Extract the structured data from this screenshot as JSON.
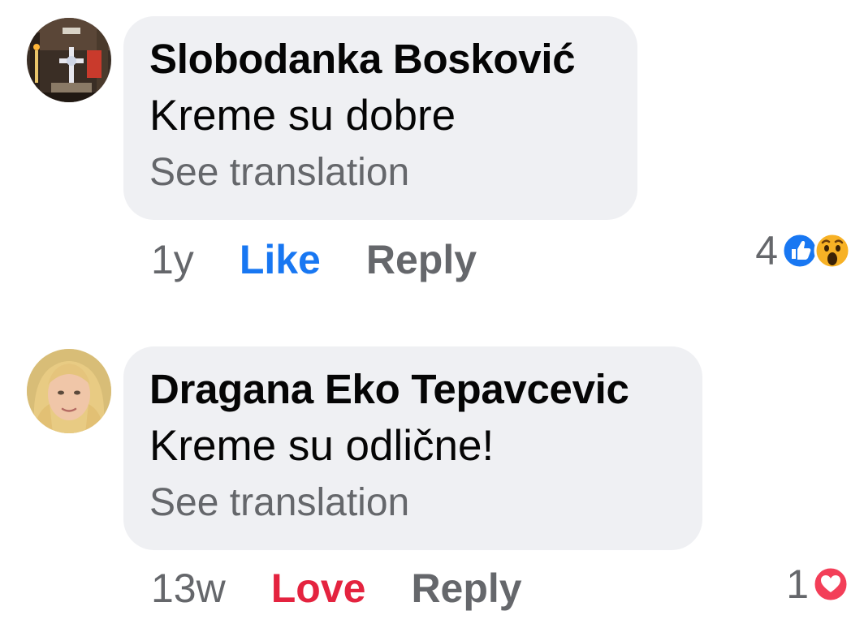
{
  "comments": [
    {
      "author": "Slobodanka Bosković",
      "text": "Kreme su dobre",
      "see_translation": "See translation",
      "time": "1y",
      "reaction_action": "Like",
      "reply": "Reply",
      "reaction_count": "4",
      "reaction_icons": [
        "like-icon",
        "wow-icon"
      ]
    },
    {
      "author": "Dragana Eko Tepavcevic",
      "text": "Kreme su odlične!",
      "see_translation": "See translation",
      "time": "13w",
      "reaction_action": "Love",
      "reply": "Reply",
      "reaction_count": "1",
      "reaction_icons": [
        "love-icon"
      ]
    }
  ],
  "colors": {
    "bubble": "#eff0f3",
    "like_blue": "#1877f2",
    "love_red": "#e4233f",
    "secondary_text": "#65676b"
  }
}
